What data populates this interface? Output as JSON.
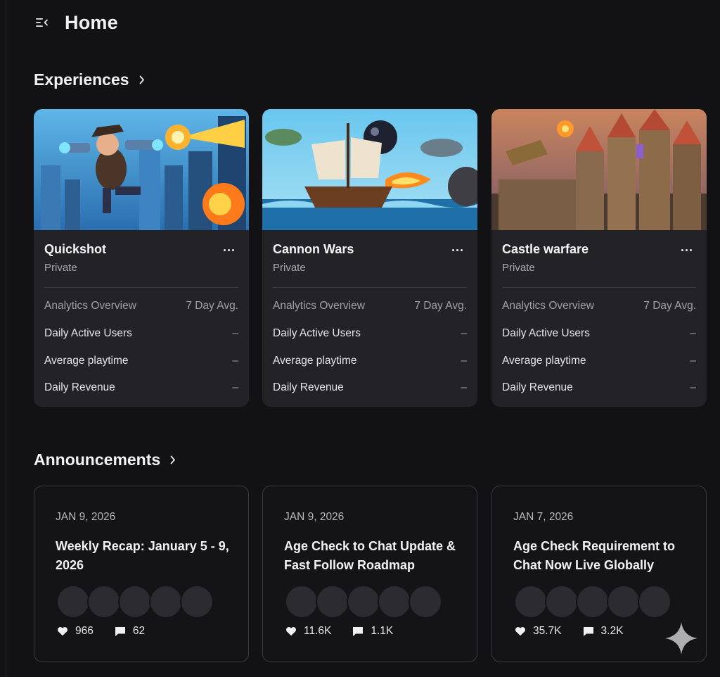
{
  "header": {
    "title": "Home",
    "menu_icon": "collapse-menu-icon"
  },
  "experiences": {
    "section_title": "Experiences",
    "cards": [
      {
        "name": "Quickshot",
        "status": "Private",
        "analytics_label": "Analytics Overview",
        "period_label": "7 Day Avg.",
        "metrics": [
          {
            "label": "Daily Active Users",
            "value": "–"
          },
          {
            "label": "Average playtime",
            "value": "–"
          },
          {
            "label": "Daily Revenue",
            "value": "–"
          }
        ]
      },
      {
        "name": "Cannon Wars",
        "status": "Private",
        "analytics_label": "Analytics Overview",
        "period_label": "7 Day Avg.",
        "metrics": [
          {
            "label": "Daily Active Users",
            "value": "–"
          },
          {
            "label": "Average playtime",
            "value": "–"
          },
          {
            "label": "Daily Revenue",
            "value": "–"
          }
        ]
      },
      {
        "name": "Castle warfare",
        "status": "Private",
        "analytics_label": "Analytics Overview",
        "period_label": "7 Day Avg.",
        "metrics": [
          {
            "label": "Daily Active Users",
            "value": "–"
          },
          {
            "label": "Average playtime",
            "value": "–"
          },
          {
            "label": "Daily Revenue",
            "value": "–"
          }
        ]
      }
    ]
  },
  "announcements": {
    "section_title": "Announcements",
    "cards": [
      {
        "date": "JAN 9, 2026",
        "title": "Weekly Recap: January 5 - 9, 2026",
        "likes": "966",
        "comments": "62"
      },
      {
        "date": "JAN 9, 2026",
        "title": "Age Check to Chat Update & Fast Follow Roadmap",
        "likes": "11.6K",
        "comments": "1.1K"
      },
      {
        "date": "JAN 7, 2026",
        "title": "Age Check Requirement to Chat Now Live Globally",
        "likes": "35.7K",
        "comments": "3.2K"
      }
    ]
  },
  "colors": {
    "background": "#121214",
    "card": "#232327",
    "muted_text": "#a0a0a6",
    "border": "#3a3a3f"
  }
}
